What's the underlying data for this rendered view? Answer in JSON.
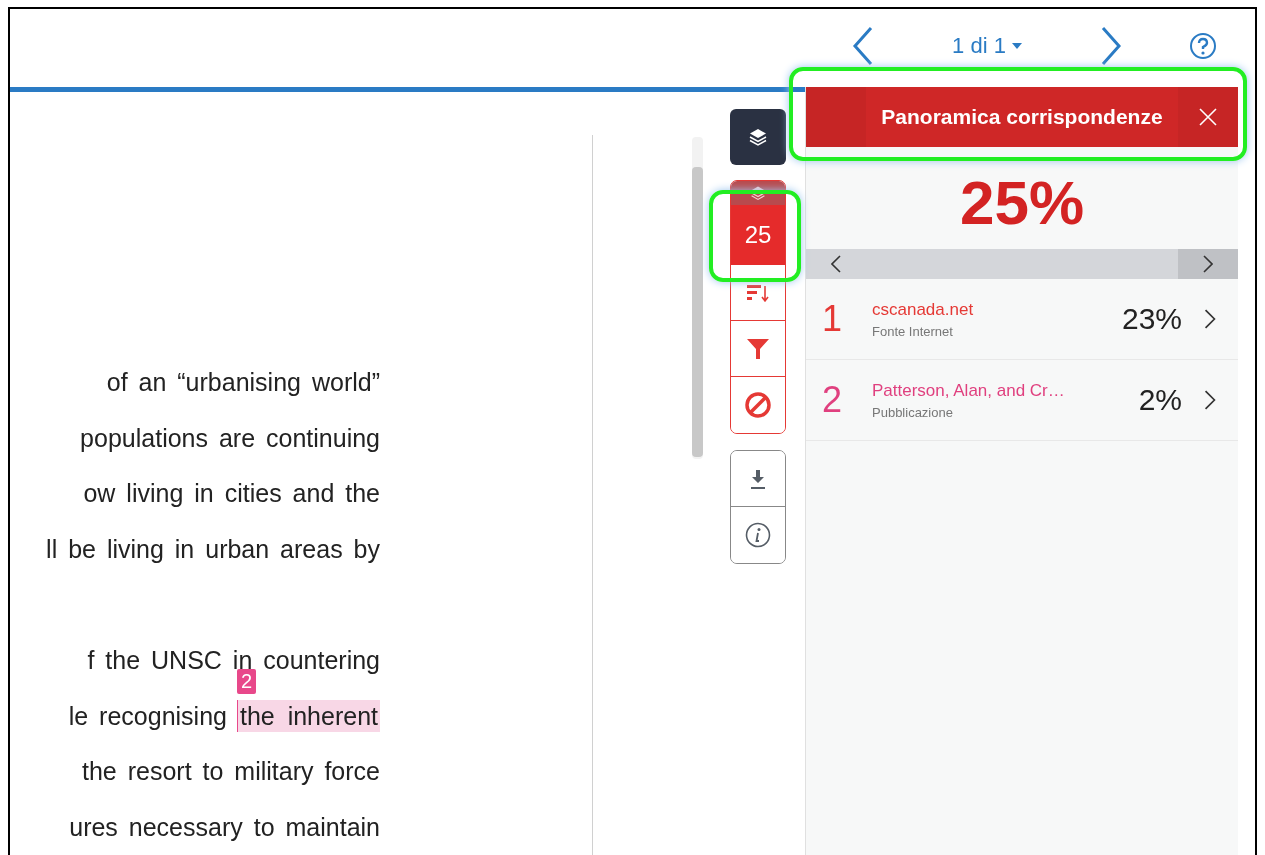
{
  "pager": {
    "label": "1 di 1"
  },
  "document": {
    "paragraphs": [
      {
        "lines": [
          {
            "text": "of an “urbanising world”"
          },
          {
            "text": "populations are continuing"
          },
          {
            "text": "ow living in cities and the"
          },
          {
            "text": "ll be living in urban areas by"
          }
        ]
      },
      {
        "lines": [
          {
            "text": "f the UNSC in countering"
          },
          {
            "text": "le recognising",
            "match": {
              "number": "2",
              "text": "the inherent",
              "color": "#e8488a"
            }
          },
          {
            "text": "the resort to military force"
          },
          {
            "text": "ures necessary to maintain"
          }
        ]
      }
    ]
  },
  "toolbar": {
    "match_count": "25"
  },
  "panel": {
    "title": "Panoramica corrispondenze",
    "score": "25%",
    "matches": [
      {
        "number": "1",
        "source": "cscanada.net",
        "type": "Fonte Internet",
        "percent": "23%",
        "color": "#e53935"
      },
      {
        "number": "2",
        "source": "Patterson, Alan, and Cr…",
        "type": "Pubblicazione",
        "percent": "2%",
        "color": "#e0407f"
      }
    ]
  }
}
